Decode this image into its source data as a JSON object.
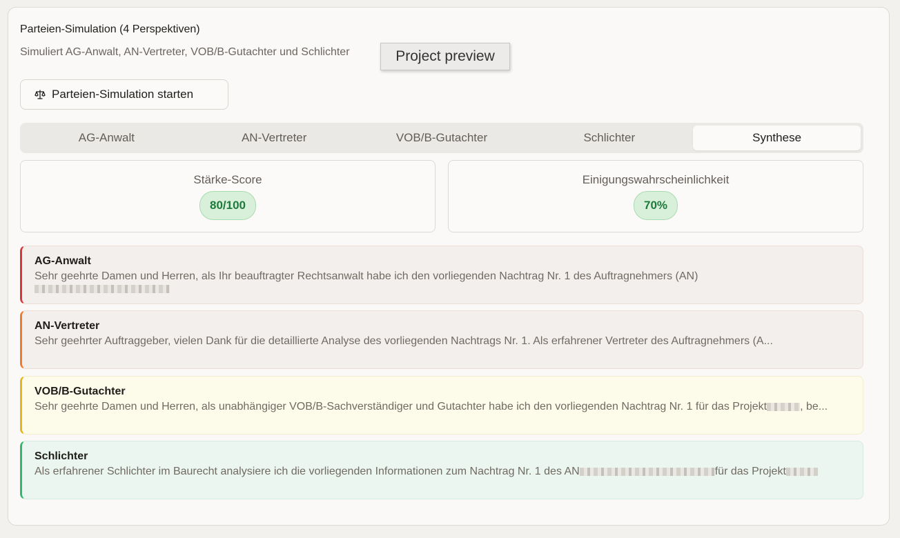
{
  "header": {
    "title": "Parteien-Simulation (4 Perspektiven)",
    "subtitle": "Simuliert AG-Anwalt, AN-Vertreter, VOB/B-Gutachter und Schlichter",
    "tooltip": "Project preview"
  },
  "start_button": {
    "label": "Parteien-Simulation starten",
    "icon": "scale-icon"
  },
  "tabs": [
    {
      "label": "AG-Anwalt",
      "active": false
    },
    {
      "label": "AN-Vertreter",
      "active": false
    },
    {
      "label": "VOB/B-Gutachter",
      "active": false
    },
    {
      "label": "Schlichter",
      "active": false
    },
    {
      "label": "Synthese",
      "active": true
    }
  ],
  "metrics": {
    "strength": {
      "label": "Stärke-Score",
      "value": "80/100"
    },
    "agreement": {
      "label": "Einigungswahrscheinlichkeit",
      "value": "70%"
    }
  },
  "perspectives": [
    {
      "title": "AG-Anwalt",
      "text": "Sehr geehrte Damen und Herren, als Ihr beauftragter Rechtsanwalt habe ich den vorliegenden Nachtrag Nr. 1 des Auftragnehmers (AN)",
      "accent": "#d9363b"
    },
    {
      "title": "AN-Vertreter",
      "text": "Sehr geehrter Auftraggeber, vielen Dank für die detaillierte Analyse des vorliegenden Nachtrags Nr. 1. Als erfahrener Vertreter des Auftragnehmers (A...",
      "accent": "#ef7a2b"
    },
    {
      "title": "VOB/B-Gutachter",
      "text_a": "Sehr geehrte Damen und Herren, als unabhängiger VOB/B-Sachverständiger und Gutachter habe ich den vorliegenden Nachtrag Nr. 1 für das Projekt",
      "text_b": ", be...",
      "accent": "#e6b51c"
    },
    {
      "title": "Schlichter",
      "text_a": "Als erfahrener Schlichter im Baurecht analysiere ich die vorliegenden Informationen zum Nachtrag Nr. 1 des AN",
      "text_b": "für das Projekt",
      "accent": "#33b86a"
    }
  ]
}
